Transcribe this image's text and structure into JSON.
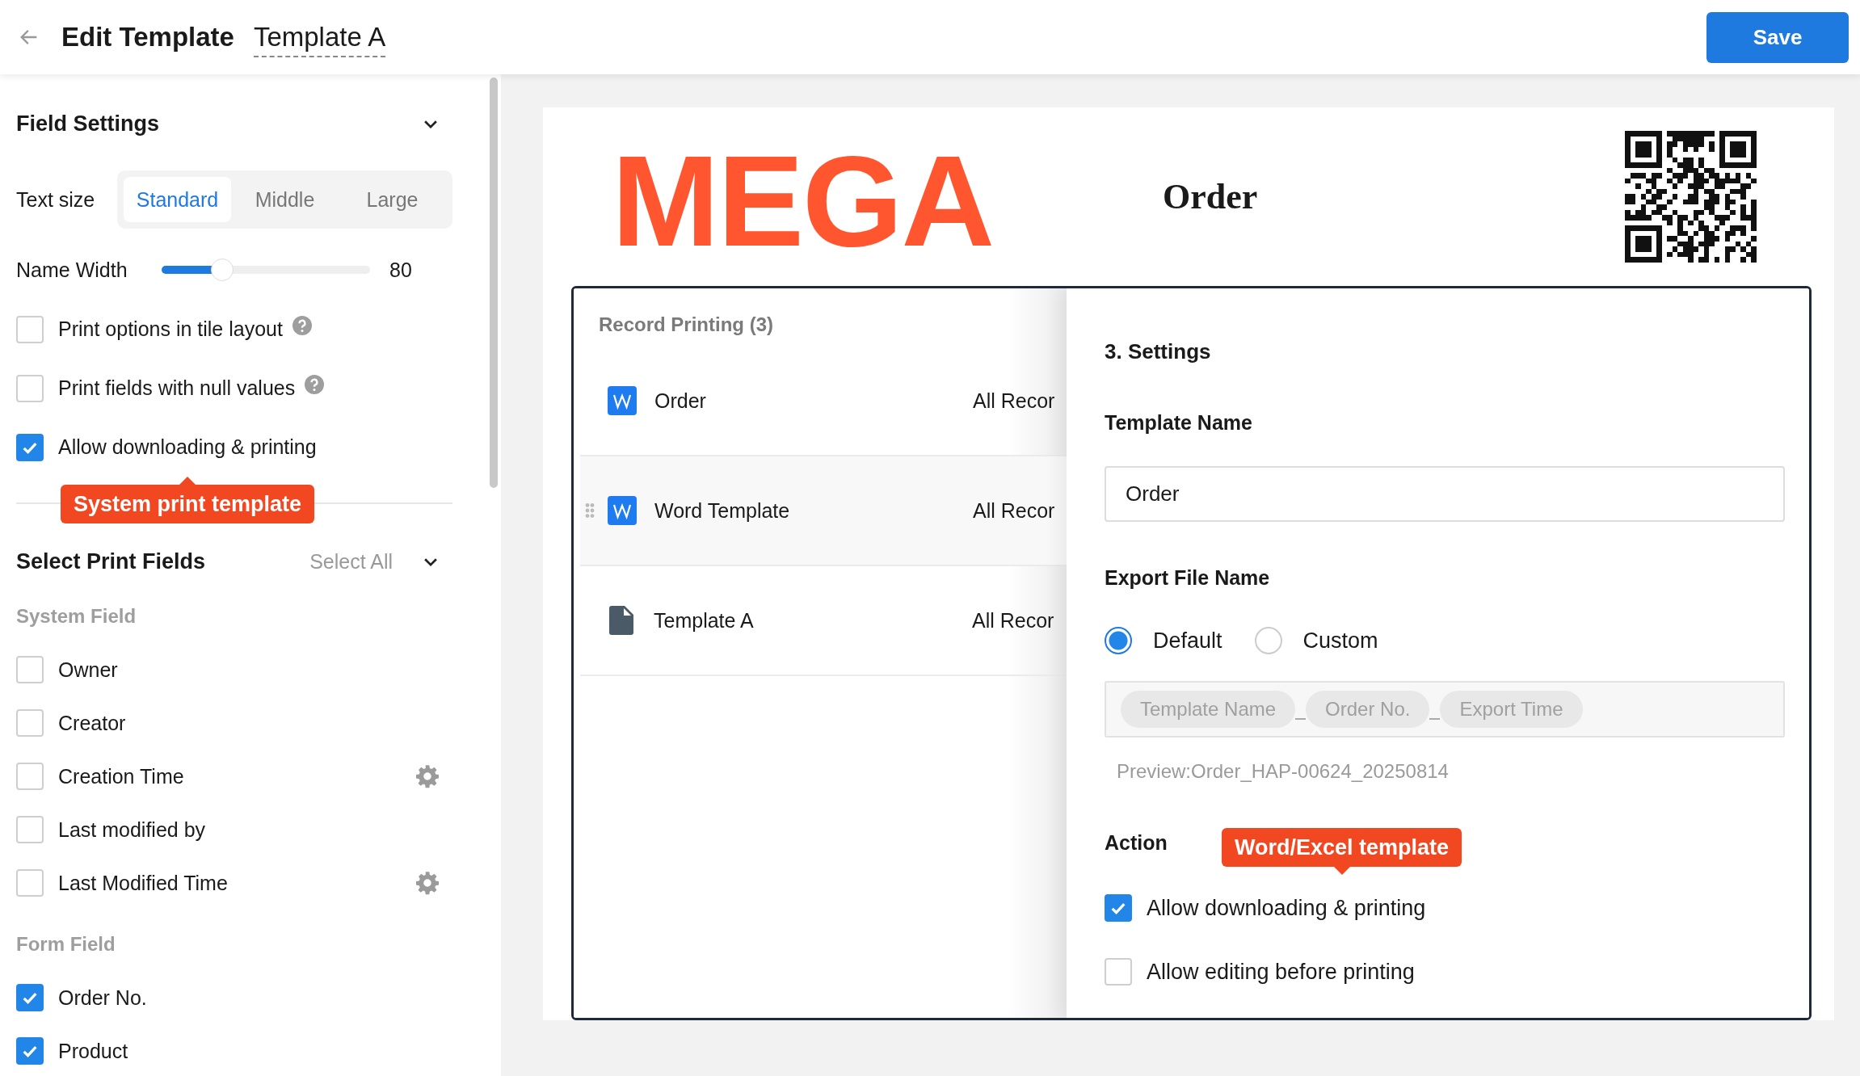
{
  "header": {
    "title": "Edit Template",
    "template_name": "Template A",
    "save_button": "Save"
  },
  "field_settings": {
    "title": "Field Settings",
    "text_size": {
      "label": "Text size",
      "options": [
        {
          "label": "Standard",
          "selected": true
        },
        {
          "label": "Middle",
          "selected": false
        },
        {
          "label": "Large",
          "selected": false
        }
      ]
    },
    "name_width": {
      "label": "Name Width",
      "level": 0.29,
      "reading": "80"
    },
    "options": [
      {
        "label": "Print options in tile layout",
        "checked": false,
        "help": true
      },
      {
        "label": "Print fields with null values",
        "checked": false,
        "help": true
      },
      {
        "label": "Allow downloading & printing",
        "checked": true,
        "help": false
      }
    ],
    "callout": "System print template"
  },
  "print_fields": {
    "title": "Select Print Fields",
    "select_all": "Select All",
    "groups": [
      {
        "title": "System Field",
        "fields": [
          {
            "label": "Owner",
            "checked": false,
            "settings": false
          },
          {
            "label": "Creator",
            "checked": false,
            "settings": false
          },
          {
            "label": "Creation Time",
            "checked": false,
            "settings": true
          },
          {
            "label": "Last modified by",
            "checked": false,
            "settings": false
          },
          {
            "label": "Last Modified Time",
            "checked": false,
            "settings": true
          }
        ]
      },
      {
        "title": "Form Field",
        "fields": [
          {
            "label": "Order No.",
            "checked": true,
            "settings": false
          },
          {
            "label": "Product",
            "checked": true,
            "settings": false
          }
        ]
      }
    ]
  },
  "document": {
    "logo": "MEGA",
    "title": "Order"
  },
  "record_printing": {
    "title": "Record Printing",
    "count": "(3)",
    "rows": [
      {
        "name": "Order",
        "kind": "word",
        "scope": "All Recor",
        "hovered": false
      },
      {
        "name": "Word Template",
        "kind": "word",
        "scope": "All Recor",
        "hovered": true
      },
      {
        "name": "Template A",
        "kind": "file",
        "scope": "All Recor",
        "hovered": false
      }
    ]
  },
  "settings": {
    "title": "3. Settings",
    "template_name_label": "Template Name",
    "template_name": "Order",
    "export_label": "Export File Name",
    "export_modes": [
      {
        "label": "Default",
        "selected": true
      },
      {
        "label": "Custom",
        "selected": false
      }
    ],
    "tokens": [
      "Template Name",
      "Order No.",
      "Export Time"
    ],
    "preview": "Preview:Order_HAP-00624_20250814",
    "action_label": "Action",
    "callout": "Word/Excel template",
    "actions": [
      {
        "label": "Allow downloading & printing",
        "checked": true
      },
      {
        "label": "Allow editing before printing",
        "checked": false
      }
    ]
  }
}
